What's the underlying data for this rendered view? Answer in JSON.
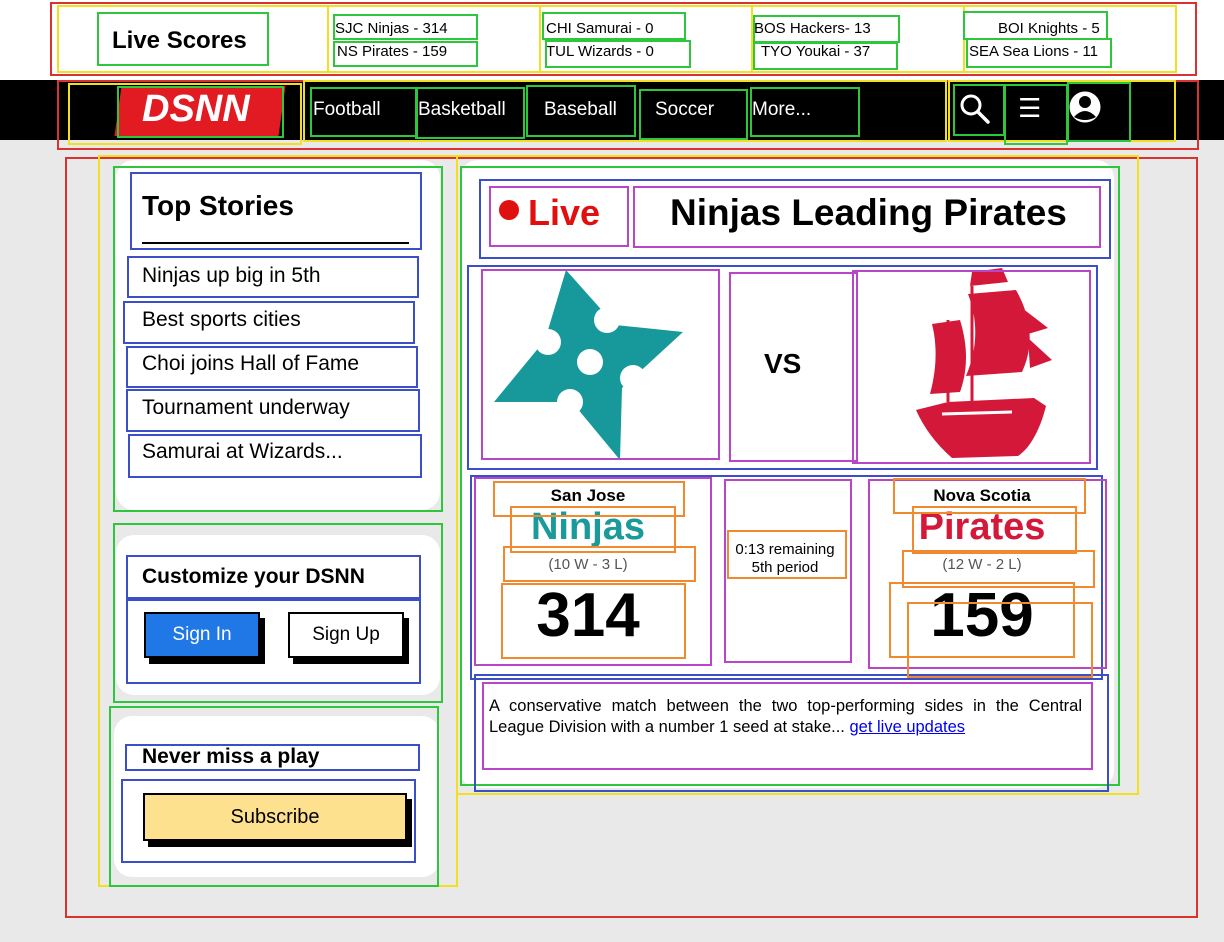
{
  "scores_bar": {
    "title": "Live Scores",
    "games": [
      {
        "line1": "SJC Ninjas - 314",
        "line2": "NS Pirates - 159"
      },
      {
        "line1": "CHI Samurai - 0",
        "line2": "TUL Wizards - 0"
      },
      {
        "line1": "BOS Hackers- 13",
        "line2": "TYO Youkai - 37"
      },
      {
        "line1": "BOI Knights - 5",
        "line2": "SEA Sea Lions - 11"
      }
    ]
  },
  "nav": {
    "logo": "DSNN",
    "links": [
      "Football",
      "Basketball",
      "Baseball",
      "Soccer",
      "More..."
    ],
    "menu_glyph": "☰",
    "icons": [
      "search-icon",
      "menu-icon",
      "user-icon"
    ]
  },
  "top_stories": {
    "heading": "Top Stories",
    "items": [
      "Ninjas up big in 5th",
      "Best sports cities",
      "Choi joins Hall of Fame",
      "Tournament underway",
      "Samurai at Wizards..."
    ]
  },
  "customize": {
    "heading": "Customize your DSNN",
    "sign_in": "Sign In",
    "sign_up": "Sign Up"
  },
  "newsletter": {
    "heading": "Never miss a play",
    "subscribe": "Subscribe"
  },
  "game": {
    "live_label": "Live",
    "headline": "Ninjas Leading Pirates",
    "vs": "VS",
    "home": {
      "city": "San Jose",
      "name": "Ninjas",
      "record": "(10 W - 3 L)",
      "score": "314",
      "color": "#1a9a9a"
    },
    "away": {
      "city": "Nova Scotia",
      "name": "Pirates",
      "record": "(12 W - 2 L)",
      "score": "159",
      "color": "#d4183a"
    },
    "time_remaining": "0:13 remaining",
    "period": "5th period",
    "description": "A conservative match between the two top-performing sides in the Central League Division with a number 1 seed at stake...",
    "link_text": "get live updates",
    "live_color": "#e01010"
  }
}
